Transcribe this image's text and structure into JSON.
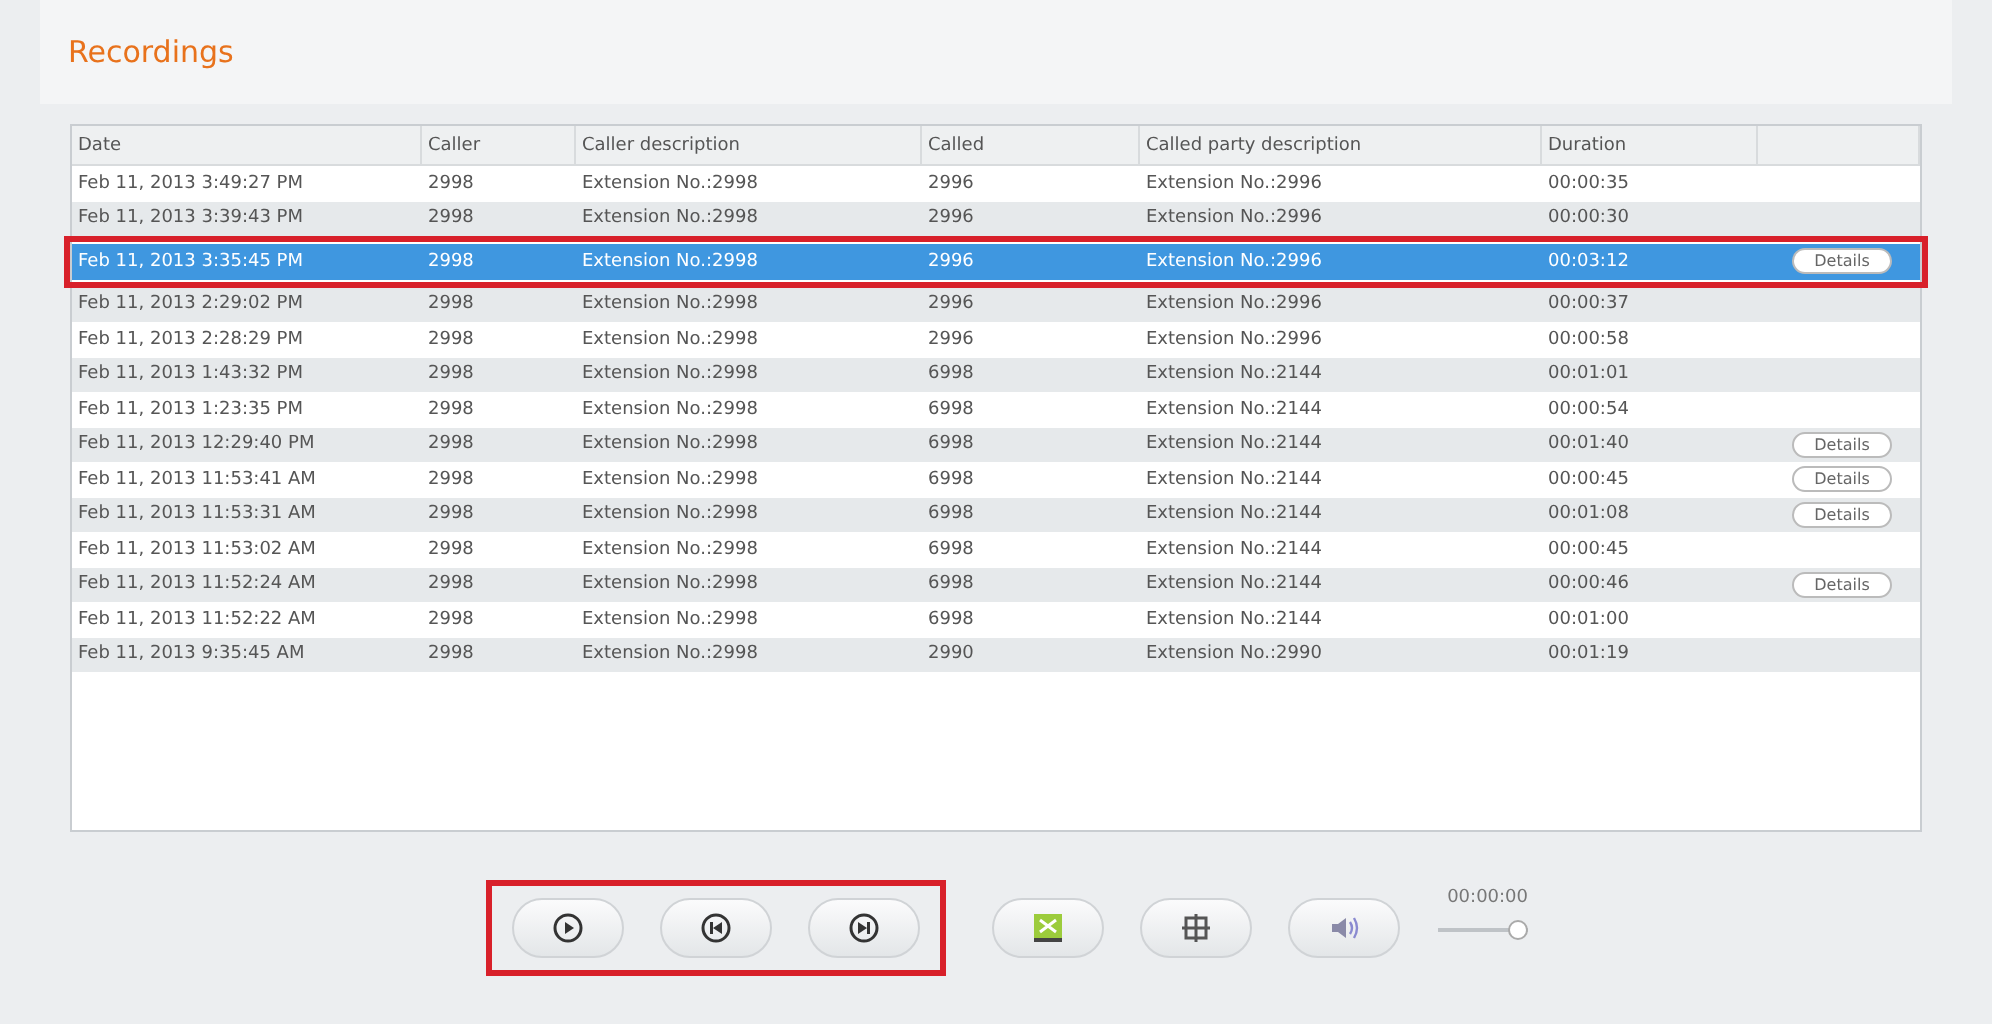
{
  "title": "Recordings",
  "table": {
    "columns": [
      "Date",
      "Caller",
      "Caller description",
      "Called",
      "Called party description",
      "Duration"
    ],
    "rows": [
      {
        "date": "Feb 11, 2013 3:49:27 PM",
        "caller": "2998",
        "caller_description": "Extension No.:2998",
        "called": "2996",
        "called_description": "Extension No.:2996",
        "duration": "00:00:35",
        "selected": false
      },
      {
        "date": "Feb 11, 2013 3:39:43 PM",
        "caller": "2998",
        "caller_description": "Extension No.:2998",
        "called": "2996",
        "called_description": "Extension No.:2996",
        "duration": "00:00:30",
        "selected": false
      },
      {
        "date": "Feb 11, 2013 3:35:45 PM",
        "caller": "2998",
        "caller_description": "Extension No.:2998",
        "called": "2996",
        "called_description": "Extension No.:2996",
        "duration": "00:03:12",
        "details": "Details",
        "selected": true
      },
      {
        "date": "Feb 11, 2013 2:29:02 PM",
        "caller": "2998",
        "caller_description": "Extension No.:2998",
        "called": "2996",
        "called_description": "Extension No.:2996",
        "duration": "00:00:37",
        "selected": false
      },
      {
        "date": "Feb 11, 2013 2:28:29 PM",
        "caller": "2998",
        "caller_description": "Extension No.:2998",
        "called": "2996",
        "called_description": "Extension No.:2996",
        "duration": "00:00:58",
        "selected": false
      },
      {
        "date": "Feb 11, 2013 1:43:32 PM",
        "caller": "2998",
        "caller_description": "Extension No.:2998",
        "called": "6998",
        "called_description": "Extension No.:2144",
        "duration": "00:01:01",
        "selected": false
      },
      {
        "date": "Feb 11, 2013 1:23:35 PM",
        "caller": "2998",
        "caller_description": "Extension No.:2998",
        "called": "6998",
        "called_description": "Extension No.:2144",
        "duration": "00:00:54",
        "selected": false
      },
      {
        "date": "Feb 11, 2013 12:29:40 PM",
        "caller": "2998",
        "caller_description": "Extension No.:2998",
        "called": "6998",
        "called_description": "Extension No.:2144",
        "duration": "00:01:40",
        "details": "Details",
        "selected": false
      },
      {
        "date": "Feb 11, 2013 11:53:41 AM",
        "caller": "2998",
        "caller_description": "Extension No.:2998",
        "called": "6998",
        "called_description": "Extension No.:2144",
        "duration": "00:00:45",
        "details": "Details",
        "selected": false
      },
      {
        "date": "Feb 11, 2013 11:53:31 AM",
        "caller": "2998",
        "caller_description": "Extension No.:2998",
        "called": "6998",
        "called_description": "Extension No.:2144",
        "duration": "00:01:08",
        "details": "Details",
        "selected": false
      },
      {
        "date": "Feb 11, 2013 11:53:02 AM",
        "caller": "2998",
        "caller_description": "Extension No.:2998",
        "called": "6998",
        "called_description": "Extension No.:2144",
        "duration": "00:00:45",
        "selected": false
      },
      {
        "date": "Feb 11, 2013 11:52:24 AM",
        "caller": "2998",
        "caller_description": "Extension No.:2998",
        "called": "6998",
        "called_description": "Extension No.:2144",
        "duration": "00:00:46",
        "details": "Details",
        "selected": false
      },
      {
        "date": "Feb 11, 2013 11:52:22 AM",
        "caller": "2998",
        "caller_description": "Extension No.:2998",
        "called": "6998",
        "called_description": "Extension No.:2144",
        "duration": "00:01:00",
        "selected": false
      },
      {
        "date": "Feb 11, 2013 9:35:45 AM",
        "caller": "2998",
        "caller_description": "Extension No.:2998",
        "called": "2990",
        "called_description": "Extension No.:2990",
        "duration": "00:01:19",
        "selected": false
      }
    ]
  },
  "player": {
    "controls": [
      {
        "kind": "play"
      },
      {
        "kind": "previous"
      },
      {
        "kind": "next"
      },
      {
        "kind": "export"
      },
      {
        "kind": "image"
      },
      {
        "kind": "volume"
      }
    ],
    "time": "00:00:00",
    "volume": {
      "level": 1
    }
  }
}
